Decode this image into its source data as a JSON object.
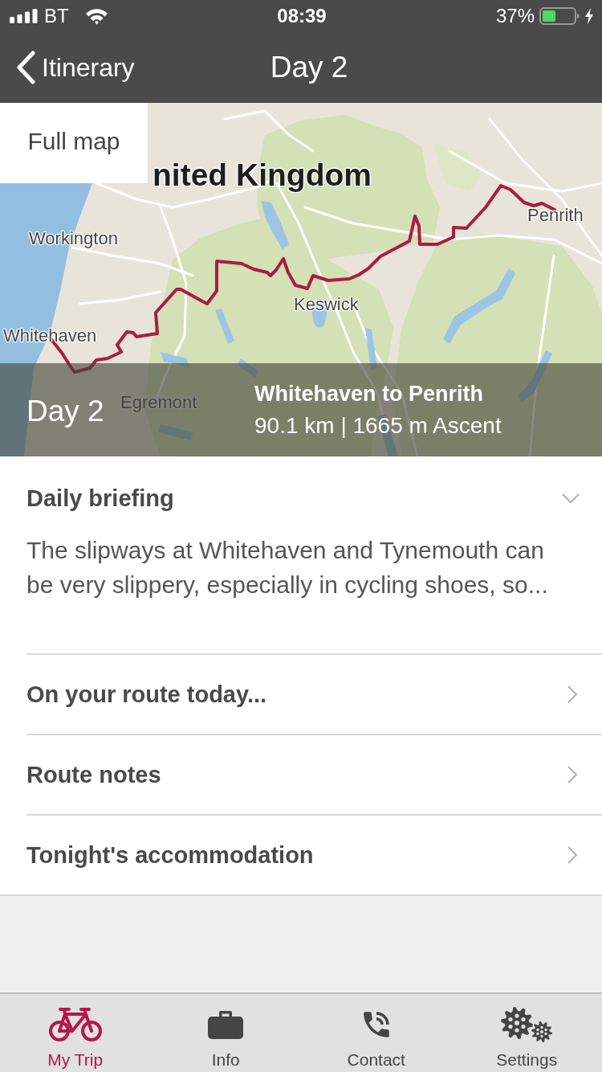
{
  "status_bar": {
    "carrier": "BT",
    "time": "08:39",
    "battery": "37%"
  },
  "nav_bar": {
    "back": "Itinerary",
    "title": "Day 2"
  },
  "map": {
    "full_map_button": "Full map",
    "labels": [
      {
        "text": "nited Kingdom",
        "kind": "country"
      },
      {
        "text": "Penrith",
        "kind": "town"
      },
      {
        "text": "Workington",
        "kind": "town"
      },
      {
        "text": "Keswick",
        "kind": "town"
      },
      {
        "text": "Whitehaven",
        "kind": "town"
      },
      {
        "text": "Egremont",
        "kind": "town"
      }
    ],
    "caption": {
      "day": "Day 2",
      "route": "Whitehaven to Penrith",
      "stats": "90.1 km | 1665 m Ascent"
    }
  },
  "briefing": {
    "title": "Daily briefing",
    "expanded": true,
    "text": "The slipways at Whitehaven and Tynemouth can be very slippery, especially in cycling shoes, so..."
  },
  "menu_items": [
    {
      "label": "On your route today..."
    },
    {
      "label": "Route notes"
    },
    {
      "label": "Tonight's accommodation"
    }
  ],
  "tab_bar": [
    {
      "label": "My Trip",
      "kind": "bicycle",
      "selected": true
    },
    {
      "label": "Info",
      "kind": "briefcase",
      "selected": false
    },
    {
      "label": "Contact",
      "kind": "phone",
      "selected": false
    },
    {
      "label": "Settings",
      "kind": "gears",
      "selected": false
    }
  ]
}
